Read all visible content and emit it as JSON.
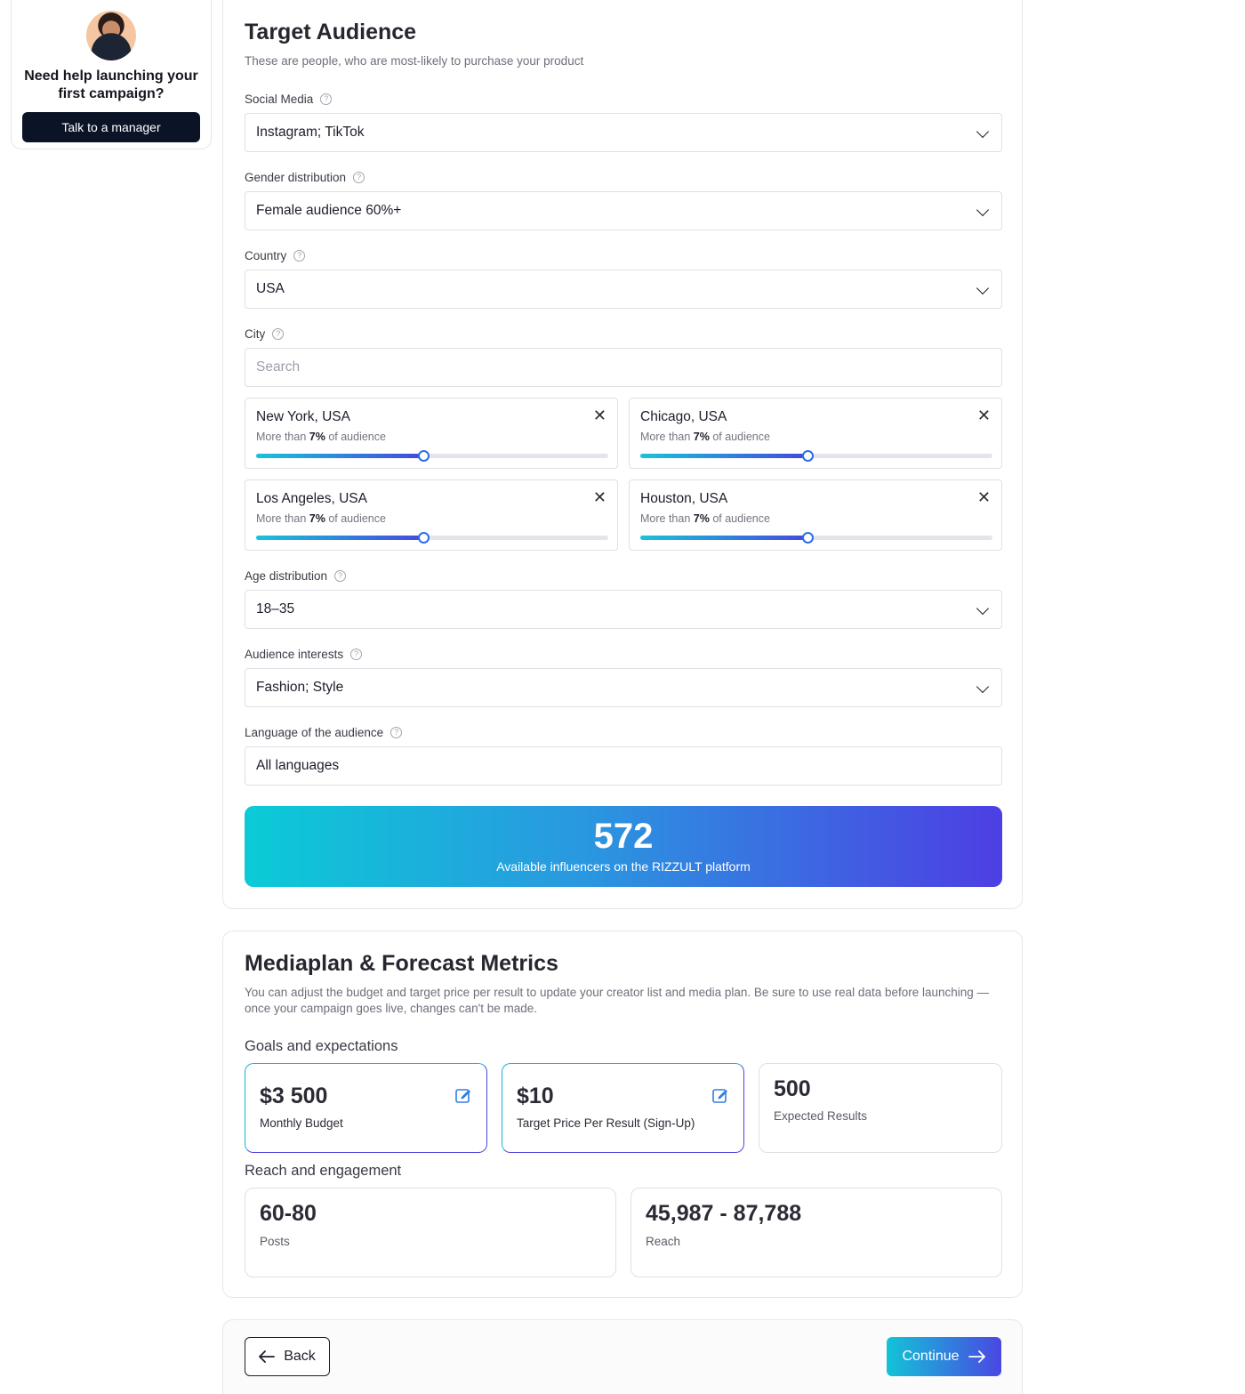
{
  "help": {
    "title": "Need help launching your first campaign?",
    "button": "Talk to a manager"
  },
  "target": {
    "title": "Target Audience",
    "subtitle": "These are people, who are most-likely to purchase your product",
    "social": {
      "label": "Social Media",
      "value": "Instagram; TikTok"
    },
    "gender": {
      "label": "Gender distribution",
      "value": "Female audience 60%+"
    },
    "country": {
      "label": "Country",
      "value": "USA"
    },
    "city": {
      "label": "City",
      "placeholder": "Search"
    },
    "cities": [
      {
        "name": "New York, USA",
        "prefix": "More than",
        "pct": "7%",
        "suffix": "of audience",
        "level": 0.475
      },
      {
        "name": "Chicago, USA",
        "prefix": "More than",
        "pct": "7%",
        "suffix": "of audience",
        "level": 0.475
      },
      {
        "name": "Los Angeles, USA",
        "prefix": "More than",
        "pct": "7%",
        "suffix": "of audience",
        "level": 0.475
      },
      {
        "name": "Houston, USA",
        "prefix": "More than",
        "pct": "7%",
        "suffix": "of audience",
        "level": 0.475
      }
    ],
    "age": {
      "label": "Age distribution",
      "value": "18–35"
    },
    "interests": {
      "label": "Audience interests",
      "value": "Fashion; Style"
    },
    "language": {
      "label": "Language of the audience",
      "value": "All languages"
    },
    "influencers": {
      "count": "572",
      "text": "Available influencers on the RIZZULT platform"
    }
  },
  "mediaplan": {
    "title": "Mediaplan & Forecast Metrics",
    "subtitle": "You can adjust the budget and target price per result to update your creator list and media plan. Be sure to use real data before launching — once your campaign goes live, changes can't be made.",
    "goals_heading": "Goals and expectations",
    "budget": {
      "value": "$3 500",
      "label": "Monthly Budget"
    },
    "price": {
      "value": "$10",
      "label": "Target Price Per Result (Sign-Up)"
    },
    "expected": {
      "value": "500",
      "label": "Expected Results"
    },
    "reach_heading": "Reach and engagement",
    "posts": {
      "value": "60-80",
      "label": "Posts"
    },
    "reach": {
      "value": "45,987 - 87,788",
      "label": "Reach"
    }
  },
  "nav": {
    "back": "Back",
    "continue": "Continue"
  },
  "colors": {
    "accent_start": "#0bcbd6",
    "accent_end": "#4d3ee3",
    "dark_button": "#0b1327"
  }
}
